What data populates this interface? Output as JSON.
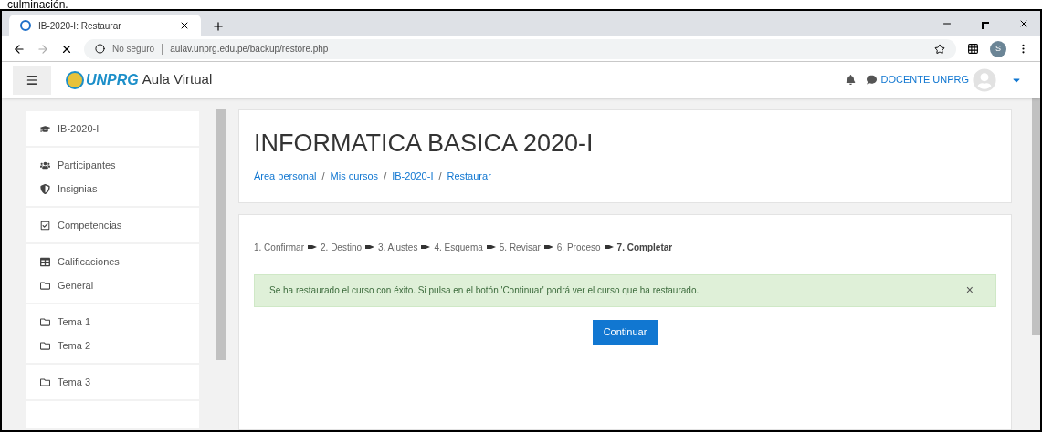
{
  "caption": "culminación.",
  "browser": {
    "tab_title": "IB-2020-I: Restaurar",
    "security": "No seguro",
    "url": "aulav.unprg.edu.pe/backup/restore.php",
    "profile_initial": "S"
  },
  "navbar": {
    "logo_text": "UNPRG",
    "site_name": "Aula Virtual",
    "user_name": "DOCENTE UNPRG"
  },
  "sidebar": {
    "groups": [
      [
        {
          "kind": "course",
          "label": "IB-2020-I"
        }
      ],
      [
        {
          "kind": "users",
          "label": "Participantes"
        },
        {
          "kind": "badge",
          "label": "Insignias"
        }
      ],
      [
        {
          "kind": "check",
          "label": "Competencias"
        }
      ],
      [
        {
          "kind": "table",
          "label": "Calificaciones"
        },
        {
          "kind": "folder",
          "label": "General"
        }
      ],
      [
        {
          "kind": "folder",
          "label": "Tema 1"
        },
        {
          "kind": "folder",
          "label": "Tema 2"
        }
      ],
      [
        {
          "kind": "folder",
          "label": "Tema 3"
        }
      ]
    ]
  },
  "header": {
    "title": "INFORMATICA BASICA 2020-I",
    "breadcrumb": [
      "Área personal",
      "Mis cursos",
      "IB-2020-I",
      "Restaurar"
    ],
    "separator": "/"
  },
  "steps": [
    {
      "label": "1. Confirmar",
      "selected": false
    },
    {
      "label": "2. Destino",
      "selected": false
    },
    {
      "label": "3. Ajustes",
      "selected": false
    },
    {
      "label": "4. Esquema",
      "selected": false
    },
    {
      "label": "5. Revisar",
      "selected": false
    },
    {
      "label": "6. Proceso",
      "selected": false
    },
    {
      "label": "7. Completar",
      "selected": true
    }
  ],
  "alert": {
    "message": "Se ha restaurado el curso con éxito. Si pulsa en el botón 'Continuar' podrá ver el curso que ha restaurado.",
    "close": "×"
  },
  "continue_button": "Continuar"
}
